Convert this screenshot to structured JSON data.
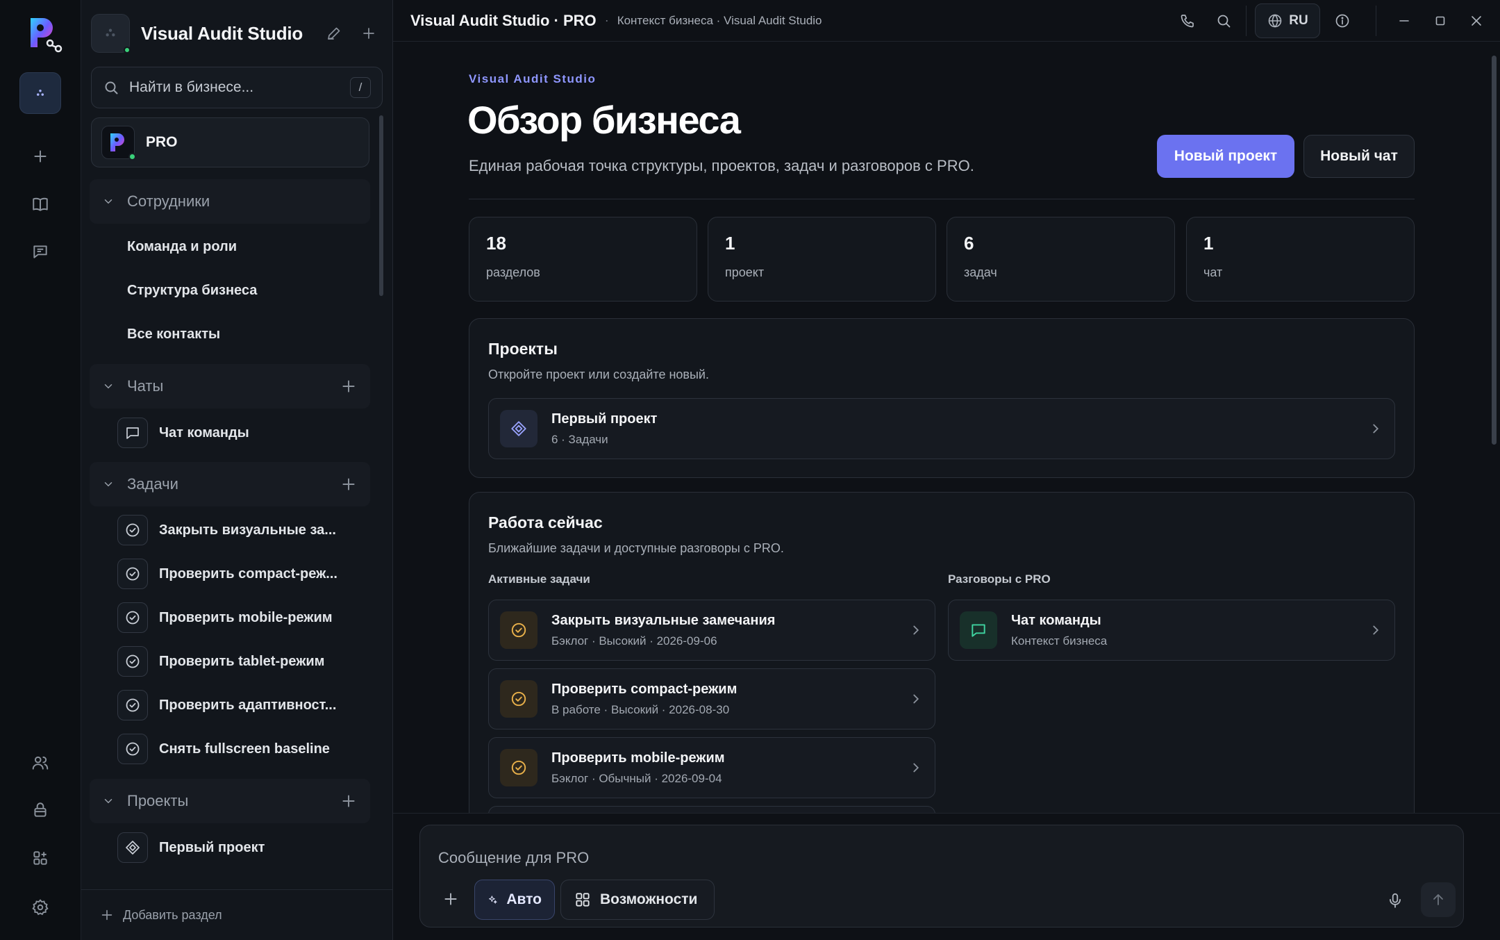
{
  "app": {
    "workspace_name": "Visual Audit Studio",
    "title": "Visual Audit Studio · PRO",
    "breadcrumb": "Контекст бизнеса · Visual Audit Studio",
    "language": "RU"
  },
  "sidebar": {
    "search_placeholder": "Найти в бизнесе...",
    "search_shortcut": "/",
    "pro_label": "PRO",
    "sections": {
      "staff": {
        "label": "Сотрудники",
        "items": [
          "Команда и роли",
          "Структура бизнеса",
          "Все контакты"
        ]
      },
      "chats": {
        "label": "Чаты",
        "items": [
          "Чат команды"
        ]
      },
      "tasks": {
        "label": "Задачи",
        "items": [
          "Закрыть визуальные за...",
          "Проверить compact-реж...",
          "Проверить mobile-режим",
          "Проверить tablet-режим",
          "Проверить адаптивност...",
          "Снять fullscreen baseline"
        ]
      },
      "projects": {
        "label": "Проекты",
        "items": [
          "Первый проект"
        ]
      }
    },
    "add_section": "Добавить раздел"
  },
  "main": {
    "eyebrow": "Visual Audit Studio",
    "title": "Обзор бизнеса",
    "subtitle": "Единая рабочая точка структуры, проектов, задач и разговоров с PRO.",
    "new_project_button": "Новый проект",
    "new_chat_button": "Новый чат",
    "stats": [
      {
        "value": "18",
        "label": "разделов"
      },
      {
        "value": "1",
        "label": "проект"
      },
      {
        "value": "6",
        "label": "задач"
      },
      {
        "value": "1",
        "label": "чат"
      }
    ],
    "projects_card": {
      "title": "Проекты",
      "subtitle": "Откройте проект или создайте новый.",
      "items": [
        {
          "title": "Первый проект",
          "meta": "6 · Задачи"
        }
      ]
    },
    "work_card": {
      "title": "Работа сейчас",
      "subtitle": "Ближайшие задачи и доступные разговоры с PRO.",
      "tasks_label": "Активные задачи",
      "chats_label": "Разговоры с PRO",
      "tasks": [
        {
          "title": "Закрыть визуальные замечания",
          "meta": "Бэклог · Высокий · 2026-09-06"
        },
        {
          "title": "Проверить compact-режим",
          "meta": "В работе · Высокий · 2026-08-30"
        },
        {
          "title": "Проверить mobile-режим",
          "meta": "Бэклог · Обычный · 2026-09-04"
        }
      ],
      "chats": [
        {
          "title": "Чат команды",
          "meta": "Контекст бизнеса"
        }
      ]
    }
  },
  "composer": {
    "placeholder": "Сообщение для PRO",
    "auto_label": "Авто",
    "capabilities_label": "Возможности"
  },
  "colors": {
    "accent": "#6b72f0",
    "eyebrow": "#8f97ff",
    "task_icon": "#e8b04a",
    "chat_icon": "#3fd4a0",
    "online": "#3ad07a"
  }
}
